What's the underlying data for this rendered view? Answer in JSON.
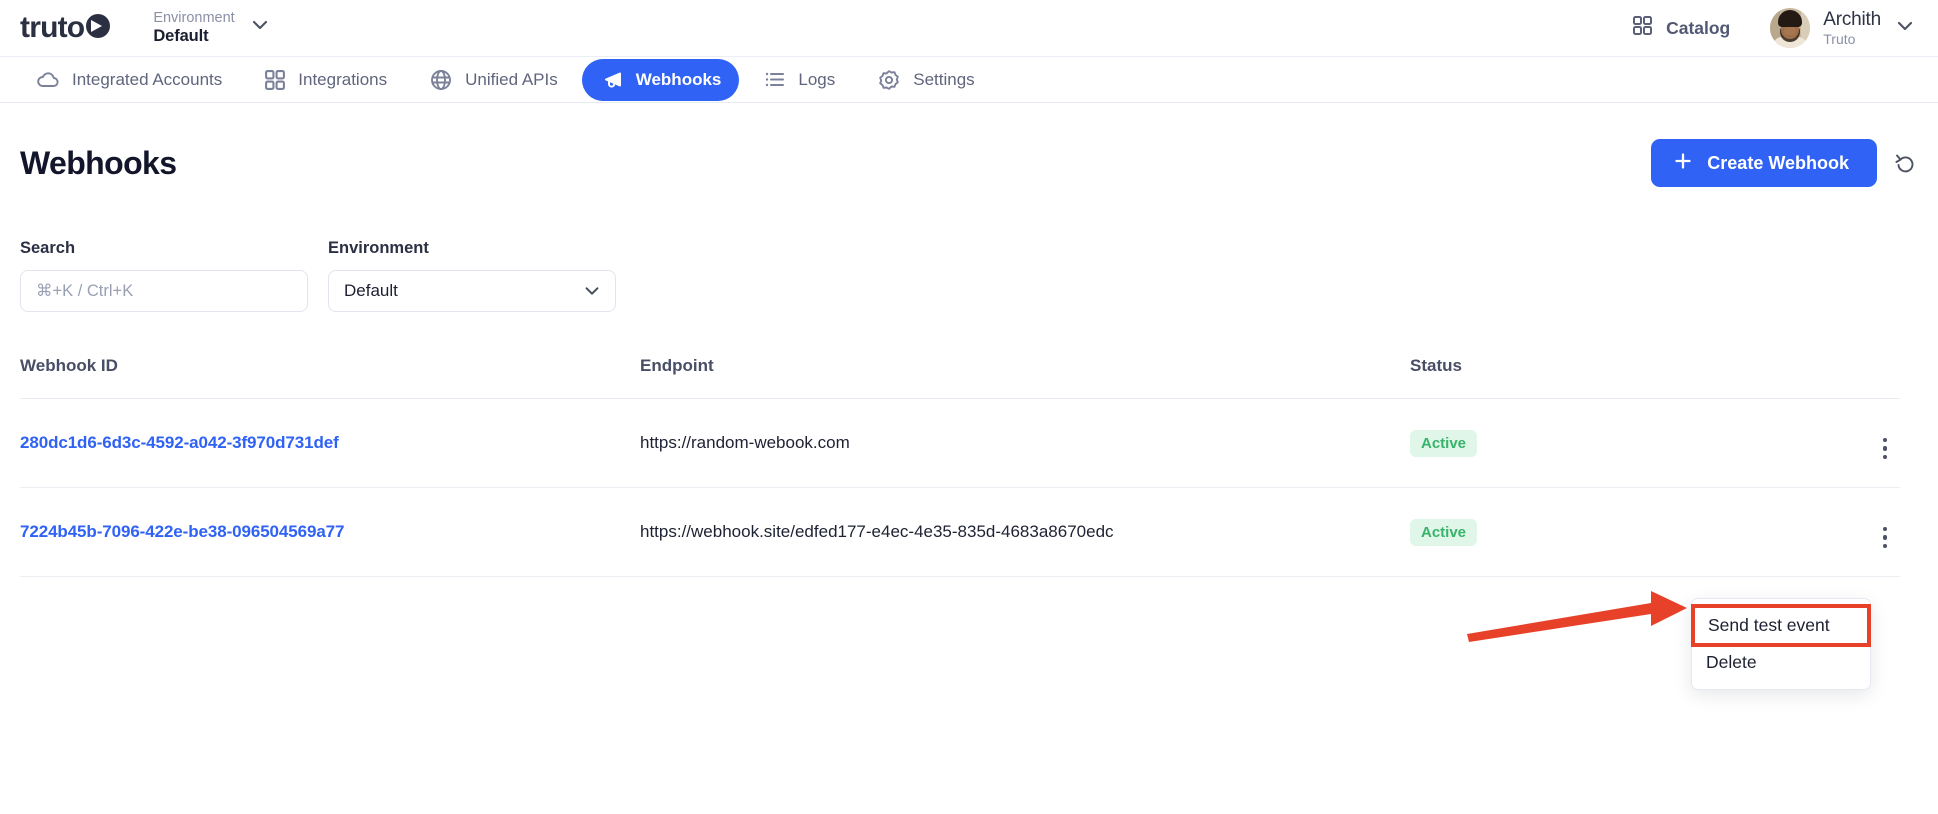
{
  "brand": {
    "logo_text": "truto",
    "logo_icon": "truto-pie-play-mark"
  },
  "header": {
    "environment_label": "Environment",
    "environment_value": "Default",
    "environment_chevron_icon": "chevron-down-icon",
    "catalog_label": "Catalog",
    "catalog_icon": "grid-icon",
    "user_name": "Archith",
    "user_org": "Truto",
    "user_chevron_icon": "chevron-down-icon",
    "avatar_icon": "user-avatar-photo"
  },
  "nav": {
    "items": [
      {
        "label": "Integrated Accounts",
        "icon": "cloud-icon",
        "active": false
      },
      {
        "label": "Integrations",
        "icon": "grid-icon",
        "active": false
      },
      {
        "label": "Unified APIs",
        "icon": "globe-icon",
        "active": false
      },
      {
        "label": "Webhooks",
        "icon": "megaphone-icon",
        "active": true
      },
      {
        "label": "Logs",
        "icon": "list-icon",
        "active": false
      },
      {
        "label": "Settings",
        "icon": "gear-icon",
        "active": false
      }
    ]
  },
  "page": {
    "title": "Webhooks",
    "create_button_label": "Create Webhook",
    "create_button_icon": "plus-icon",
    "refresh_icon": "refresh-undo-icon",
    "accent_color": "#2f62f5"
  },
  "filters": {
    "search_label": "Search",
    "search_value": "",
    "search_placeholder": "⌘+K / Ctrl+K",
    "environment_label": "Environment",
    "environment_value": "Default",
    "environment_chevron_icon": "chevron-down-icon"
  },
  "table": {
    "columns": [
      "Webhook ID",
      "Endpoint",
      "Status",
      ""
    ],
    "rows": [
      {
        "id": "280dc1d6-6d3c-4592-a042-3f970d731def",
        "endpoint": "https://random-webook.com",
        "status": "Active",
        "actions_icon": "kebab-menu-icon"
      },
      {
        "id": "7224b45b-7096-422e-be38-096504569a77",
        "endpoint": "https://webhook.site/edfed177-e4ec-4e35-835d-4683a8670edc",
        "status": "Active",
        "actions_icon": "kebab-menu-icon"
      }
    ],
    "status_badge_bg": "#dff6e8",
    "status_badge_color": "#38b36b"
  },
  "context_menu": {
    "items": [
      {
        "label": "Send test event",
        "highlighted": true
      },
      {
        "label": "Delete",
        "highlighted": false
      }
    ]
  },
  "annotation": {
    "arrow_icon": "red-arrow-pointing-right",
    "color": "#e8412a"
  }
}
